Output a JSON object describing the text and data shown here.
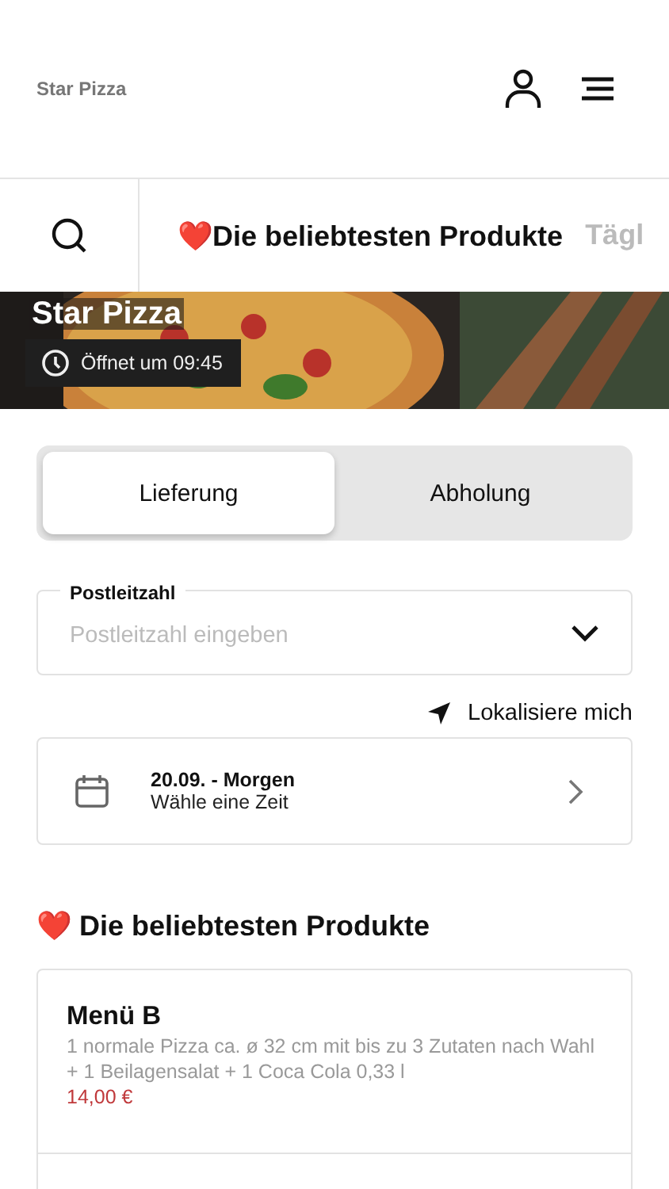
{
  "header": {
    "brand": "Star Pizza"
  },
  "category_nav": {
    "items": [
      {
        "emoji": "❤️",
        "label": "Die beliebtesten Produkte",
        "selected": true
      },
      {
        "label": "Tägl",
        "selected": false
      }
    ]
  },
  "hero": {
    "title": "Star Pizza",
    "opening": "Öffnet um 09:45"
  },
  "mode_toggle": [
    {
      "label": "Lieferung",
      "selected": true
    },
    {
      "label": "Abholung",
      "selected": false
    }
  ],
  "postcode": {
    "label": "Postleitzahl",
    "placeholder": "Postleitzahl eingeben"
  },
  "locate": "Lokalisiere mich",
  "date": {
    "title": "20.09. - Morgen",
    "subtitle": "Wähle eine Zeit"
  },
  "section": {
    "emoji": "❤️",
    "title": "Die beliebtesten Produkte"
  },
  "products": [
    {
      "name": "Menü B",
      "description": "1 normale Pizza ca. ø 32 cm mit bis zu 3 Zutaten nach Wahl + 1 Beilagensalat + 1 Coca Cola 0,33 l",
      "price": "14,00 €"
    }
  ]
}
